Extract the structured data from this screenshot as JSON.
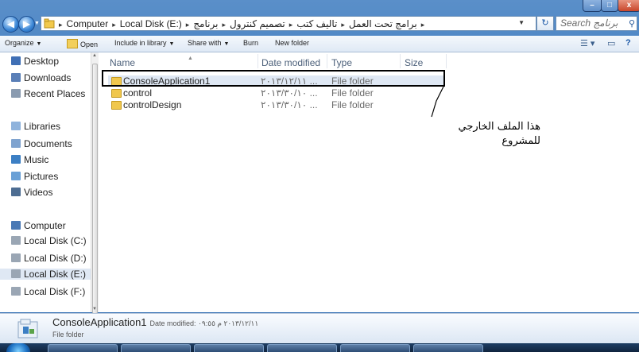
{
  "window": {
    "min_glyph": "–",
    "max_glyph": "□",
    "close_glyph": "x"
  },
  "address": {
    "crumbs": [
      "Computer",
      "Local Disk (E:)",
      "برامج تحت العمل",
      "تاليف كتب",
      "تصميم كنترول",
      "برنامج"
    ],
    "separator": "▸",
    "search_placeholder": "Search برنامج"
  },
  "toolbar": {
    "organize": "Organize",
    "open": "Open",
    "include": "Include in library",
    "share": "Share with",
    "burn": "Burn",
    "new_folder": "New folder"
  },
  "nav": {
    "favorites": [
      {
        "label": "Desktop",
        "icon": "desktop-icon",
        "color": "#3f6fb5"
      },
      {
        "label": "Downloads",
        "icon": "downloads-icon",
        "color": "#5a7fb7"
      },
      {
        "label": "Recent Places",
        "icon": "recent-places-icon",
        "color": "#8a9bb0"
      }
    ],
    "libraries_label": "Libraries",
    "libraries": [
      {
        "label": "Documents",
        "icon": "documents-icon",
        "color": "#7fa3cf"
      },
      {
        "label": "Music",
        "icon": "music-icon",
        "color": "#3c7fc4"
      },
      {
        "label": "Pictures",
        "icon": "pictures-icon",
        "color": "#6aa0d6"
      },
      {
        "label": "Videos",
        "icon": "videos-icon",
        "color": "#4d6d92"
      }
    ],
    "computer_label": "Computer",
    "drives": [
      "Local Disk (C:)",
      "Local Disk (D:)",
      "Local Disk (E:)",
      "Local Disk (F:)"
    ],
    "selected_drive": "Local Disk (E:)"
  },
  "columns": {
    "name": "Name",
    "date": "Date modified",
    "type": "Type",
    "size": "Size"
  },
  "files": [
    {
      "name": "ConsoleApplication1",
      "date": "٢٠١٣/١٢/١١ ...",
      "type": "File folder",
      "selected": true
    },
    {
      "name": "control",
      "date": "٢٠١٣/٣٠/١٠ ...",
      "type": "File folder",
      "selected": false
    },
    {
      "name": "controlDesign",
      "date": "٢٠١٣/٣٠/١٠ ...",
      "type": "File folder",
      "selected": false
    }
  ],
  "annotation": {
    "line1": "هذا الملف الخارجي",
    "line2": "للمشروع"
  },
  "details": {
    "name": "ConsoleApplication1",
    "meta": "Date modified: ٢٠١٣/١٢/١١ م ٠٩:٥٥",
    "type": "File folder"
  }
}
